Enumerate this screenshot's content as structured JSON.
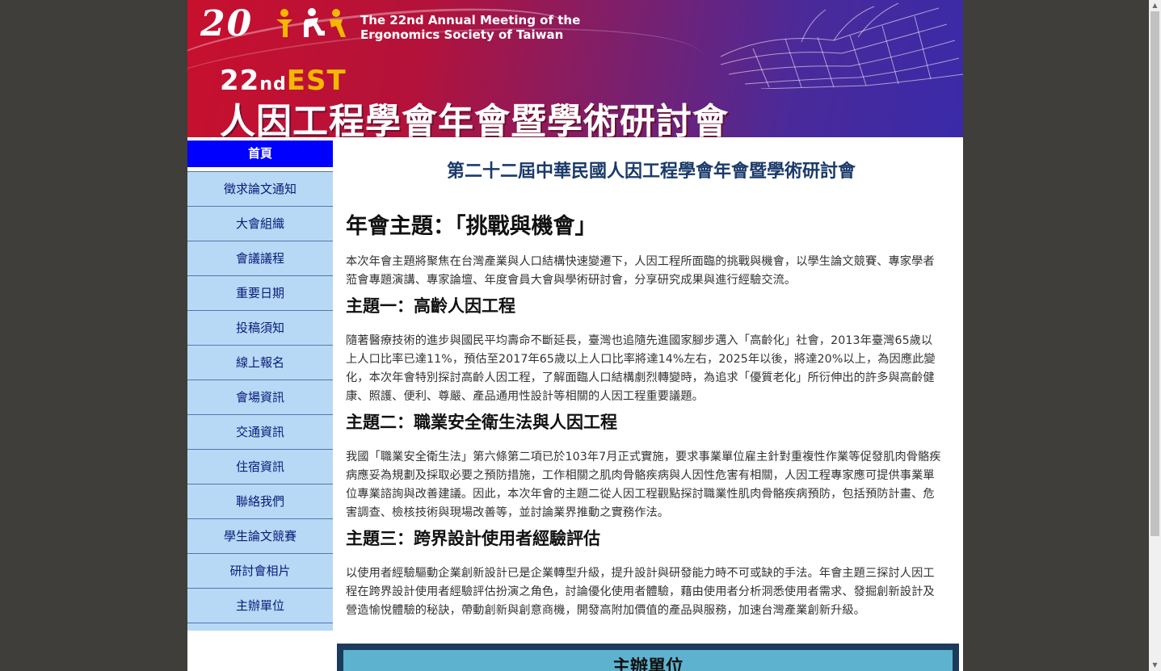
{
  "banner": {
    "year_logo": "20",
    "english_line1": "The 22nd Annual Meeting of the",
    "english_line2": "Ergonomics Society of Taiwan",
    "edition_num": "22",
    "edition_suffix": "nd",
    "edition_est": "EST",
    "chinese_title": "人因工程學會年會暨學術研討會"
  },
  "sidebar": {
    "items": [
      {
        "label": "首頁",
        "active": true
      },
      {
        "label": "徵求論文通知"
      },
      {
        "label": "大會組織"
      },
      {
        "label": "會議議程"
      },
      {
        "label": "重要日期"
      },
      {
        "label": "投稿須知"
      },
      {
        "label": "線上報名"
      },
      {
        "label": "會場資訊"
      },
      {
        "label": "交通資訊"
      },
      {
        "label": "住宿資訊"
      },
      {
        "label": "聯絡我們"
      },
      {
        "label": "學生論文競賽"
      },
      {
        "label": "研討會相片"
      },
      {
        "label": "主辦單位"
      }
    ]
  },
  "main": {
    "conference_title": "第二十二屆中華民國人因工程學會年會暨學術研討會",
    "theme_title": "年會主題：「挑戰與機會」",
    "intro": "本次年會主題將聚焦在台灣產業與人口結構快速變遷下，人因工程所面臨的挑戰與機會，以學生論文競賽、專家學者蒞會專題演講、專家論壇、年度會員大會與學術研討會，分享研究成果與進行經驗交流。",
    "topic1_title": "主題一：高齡人因工程",
    "topic1_text": "隨著醫療技術的進步與國民平均壽命不斷延長，臺灣也追隨先進國家腳步邁入「高齡化」社會，2013年臺灣65歲以上人口比率已達11%，預估至2017年65歲以上人口比率將達14%左右，2025年以後，將達20%以上，為因應此變化，本次年會特別探討高齡人因工程，了解面臨人口結構劇烈轉變時，為追求「優質老化」所衍伸出的許多與高齡健康、照護、便利、尊嚴、產品通用性設計等相關的人因工程重要議題。",
    "topic2_title": "主題二：職業安全衛生法與人因工程",
    "topic2_text": "我國「職業安全衛生法」第六條第二項已於103年7月正式實施，要求事業單位雇主針對重複性作業等促發肌肉骨骼疾病應妥為規劃及採取必要之預防措施，工作相關之肌肉骨骼疾病與人因性危害有相關，人因工程專家應可提供事業單位專業諮詢與改善建議。因此，本次年會的主題二從人因工程觀點探討職業性肌肉骨骼疾病預防，包括預防計畫、危害調查、檢核技術與現場改善等，並討論業界推動之實務作法。",
    "topic3_title": "主題三：跨界設計使用者經驗評估",
    "topic3_text": "以使用者經驗驅動企業創新設計已是企業轉型升級，提升設計與研發能力時不可或缺的手法。年會主題三探討人因工程在跨界設計使用者經驗評估扮演之角色，討論優化使用者體驗，藉由使用者分析洞悉使用者需求、發掘創新設計及營造愉悅體驗的秘訣，帶動創新與創意商機，開發高附加價值的產品與服務，加速台灣產業創新升級。",
    "host_title": "主辦單位"
  },
  "colors": {
    "nav_active_bg": "#0000ff",
    "nav_bg": "#b7d9f5",
    "nav_text": "#0a1a7a",
    "title_color": "#1a3a6a",
    "host_bg": "#5db3cf"
  }
}
